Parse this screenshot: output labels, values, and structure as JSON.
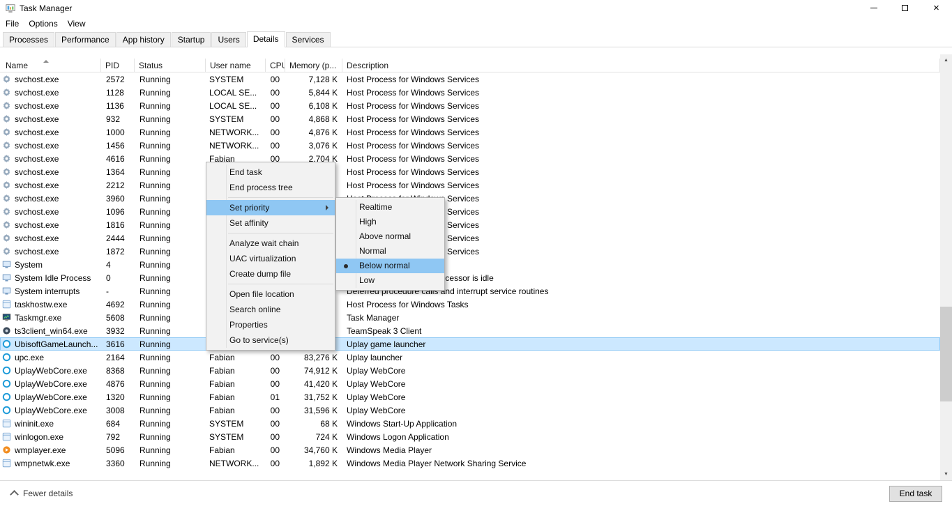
{
  "window": {
    "title": "Task Manager",
    "buttons": [
      {
        "name": "minimize"
      },
      {
        "name": "maximize"
      },
      {
        "name": "close"
      }
    ]
  },
  "menubar": {
    "items": [
      "File",
      "Options",
      "View"
    ]
  },
  "tabs": {
    "items": [
      {
        "label": "Processes"
      },
      {
        "label": "Performance"
      },
      {
        "label": "App history"
      },
      {
        "label": "Startup"
      },
      {
        "label": "Users"
      },
      {
        "label": "Details",
        "active": true
      },
      {
        "label": "Services"
      }
    ]
  },
  "table": {
    "columns": [
      {
        "id": "name",
        "label": "Name",
        "sorted": "asc"
      },
      {
        "id": "pid",
        "label": "PID"
      },
      {
        "id": "status",
        "label": "Status"
      },
      {
        "id": "user",
        "label": "User name"
      },
      {
        "id": "cpu",
        "label": "CPU"
      },
      {
        "id": "mem",
        "label": "Memory (p..."
      },
      {
        "id": "desc",
        "label": "Description"
      }
    ],
    "rows": [
      {
        "icon": "svchost",
        "name": "svchost.exe",
        "pid": "2572",
        "status": "Running",
        "user": "SYSTEM",
        "cpu": "00",
        "mem": "7,128 K",
        "desc": "Host Process for Windows Services"
      },
      {
        "icon": "svchost",
        "name": "svchost.exe",
        "pid": "1128",
        "status": "Running",
        "user": "LOCAL SE...",
        "cpu": "00",
        "mem": "5,844 K",
        "desc": "Host Process for Windows Services"
      },
      {
        "icon": "svchost",
        "name": "svchost.exe",
        "pid": "1136",
        "status": "Running",
        "user": "LOCAL SE...",
        "cpu": "00",
        "mem": "6,108 K",
        "desc": "Host Process for Windows Services"
      },
      {
        "icon": "svchost",
        "name": "svchost.exe",
        "pid": "932",
        "status": "Running",
        "user": "SYSTEM",
        "cpu": "00",
        "mem": "4,868 K",
        "desc": "Host Process for Windows Services"
      },
      {
        "icon": "svchost",
        "name": "svchost.exe",
        "pid": "1000",
        "status": "Running",
        "user": "NETWORK...",
        "cpu": "00",
        "mem": "4,876 K",
        "desc": "Host Process for Windows Services"
      },
      {
        "icon": "svchost",
        "name": "svchost.exe",
        "pid": "1456",
        "status": "Running",
        "user": "NETWORK...",
        "cpu": "00",
        "mem": "3,076 K",
        "desc": "Host Process for Windows Services"
      },
      {
        "icon": "svchost",
        "name": "svchost.exe",
        "pid": "4616",
        "status": "Running",
        "user": "Fabian",
        "cpu": "00",
        "mem": "2,704 K",
        "desc": "Host Process for Windows Services"
      },
      {
        "icon": "svchost",
        "name": "svchost.exe",
        "pid": "1364",
        "status": "Running",
        "user": "",
        "cpu": "",
        "mem": "",
        "desc": "Host Process for Windows Services"
      },
      {
        "icon": "svchost",
        "name": "svchost.exe",
        "pid": "2212",
        "status": "Running",
        "user": "",
        "cpu": "",
        "mem": "",
        "desc": "Host Process for Windows Services"
      },
      {
        "icon": "svchost",
        "name": "svchost.exe",
        "pid": "3960",
        "status": "Running",
        "user": "",
        "cpu": "",
        "mem": "",
        "desc": "Host Process for Windows Services"
      },
      {
        "icon": "svchost",
        "name": "svchost.exe",
        "pid": "1096",
        "status": "Running",
        "user": "",
        "cpu": "",
        "mem": "",
        "desc": "Host Process for Windows Services"
      },
      {
        "icon": "svchost",
        "name": "svchost.exe",
        "pid": "1816",
        "status": "Running",
        "user": "",
        "cpu": "",
        "mem": "",
        "desc": "Host Process for Windows Services"
      },
      {
        "icon": "svchost",
        "name": "svchost.exe",
        "pid": "2444",
        "status": "Running",
        "user": "",
        "cpu": "",
        "mem": "",
        "desc": "Host Process for Windows Services"
      },
      {
        "icon": "svchost",
        "name": "svchost.exe",
        "pid": "1872",
        "status": "Running",
        "user": "",
        "cpu": "",
        "mem": "",
        "desc": "Host Process for Windows Services"
      },
      {
        "icon": "system",
        "name": "System",
        "pid": "4",
        "status": "Running",
        "user": "",
        "cpu": "",
        "mem": "",
        "desc": ""
      },
      {
        "icon": "system",
        "name": "System Idle Process",
        "pid": "0",
        "status": "Running",
        "user": "",
        "cpu": "",
        "mem": "",
        "desc": "Percentage of time the processor is idle"
      },
      {
        "icon": "system",
        "name": "System interrupts",
        "pid": "-",
        "status": "Running",
        "user": "",
        "cpu": "",
        "mem": "",
        "desc": "Deferred procedure calls and interrupt service routines"
      },
      {
        "icon": "window",
        "name": "taskhostw.exe",
        "pid": "4692",
        "status": "Running",
        "user": "",
        "cpu": "",
        "mem": "",
        "desc": "Host Process for Windows Tasks"
      },
      {
        "icon": "taskmgr",
        "name": "Taskmgr.exe",
        "pid": "5608",
        "status": "Running",
        "user": "",
        "cpu": "",
        "mem": "",
        "desc": "Task Manager"
      },
      {
        "icon": "ts3",
        "name": "ts3client_win64.exe",
        "pid": "3932",
        "status": "Running",
        "user": "",
        "cpu": "",
        "mem": "",
        "desc": "TeamSpeak 3 Client"
      },
      {
        "icon": "uplay",
        "name": "UbisoftGameLaunch...",
        "pid": "3616",
        "status": "Running",
        "user": "",
        "cpu": "",
        "mem": "",
        "desc": "Uplay game launcher",
        "selected": true
      },
      {
        "icon": "uplay",
        "name": "upc.exe",
        "pid": "2164",
        "status": "Running",
        "user": "Fabian",
        "cpu": "00",
        "mem": "83,276 K",
        "desc": "Uplay launcher"
      },
      {
        "icon": "uplay",
        "name": "UplayWebCore.exe",
        "pid": "8368",
        "status": "Running",
        "user": "Fabian",
        "cpu": "00",
        "mem": "74,912 K",
        "desc": "Uplay WebCore"
      },
      {
        "icon": "uplay",
        "name": "UplayWebCore.exe",
        "pid": "4876",
        "status": "Running",
        "user": "Fabian",
        "cpu": "00",
        "mem": "41,420 K",
        "desc": "Uplay WebCore"
      },
      {
        "icon": "uplay",
        "name": "UplayWebCore.exe",
        "pid": "1320",
        "status": "Running",
        "user": "Fabian",
        "cpu": "01",
        "mem": "31,752 K",
        "desc": "Uplay WebCore"
      },
      {
        "icon": "uplay",
        "name": "UplayWebCore.exe",
        "pid": "3008",
        "status": "Running",
        "user": "Fabian",
        "cpu": "00",
        "mem": "31,596 K",
        "desc": "Uplay WebCore"
      },
      {
        "icon": "window",
        "name": "wininit.exe",
        "pid": "684",
        "status": "Running",
        "user": "SYSTEM",
        "cpu": "00",
        "mem": "68 K",
        "desc": "Windows Start-Up Application"
      },
      {
        "icon": "window",
        "name": "winlogon.exe",
        "pid": "792",
        "status": "Running",
        "user": "SYSTEM",
        "cpu": "00",
        "mem": "724 K",
        "desc": "Windows Logon Application"
      },
      {
        "icon": "wmp",
        "name": "wmplayer.exe",
        "pid": "5096",
        "status": "Running",
        "user": "Fabian",
        "cpu": "00",
        "mem": "34,760 K",
        "desc": "Windows Media Player"
      },
      {
        "icon": "window",
        "name": "wmpnetwk.exe",
        "pid": "3360",
        "status": "Running",
        "user": "NETWORK...",
        "cpu": "00",
        "mem": "1,892 K",
        "desc": "Windows Media Player Network Sharing Service"
      }
    ]
  },
  "context_menu": {
    "items": [
      {
        "label": "End task"
      },
      {
        "label": "End process tree"
      },
      {
        "separator": true
      },
      {
        "label": "Set priority",
        "highlighted": true,
        "has_submenu": true
      },
      {
        "label": "Set affinity"
      },
      {
        "separator": true
      },
      {
        "label": "Analyze wait chain"
      },
      {
        "label": "UAC virtualization"
      },
      {
        "label": "Create dump file"
      },
      {
        "separator": true
      },
      {
        "label": "Open file location"
      },
      {
        "label": "Search online"
      },
      {
        "label": "Properties"
      },
      {
        "label": "Go to service(s)"
      }
    ]
  },
  "priority_submenu": {
    "items": [
      {
        "label": "Realtime"
      },
      {
        "label": "High"
      },
      {
        "label": "Above normal"
      },
      {
        "label": "Normal"
      },
      {
        "label": "Below normal",
        "highlighted": true,
        "selected_radio": true
      },
      {
        "label": "Low"
      }
    ]
  },
  "footer": {
    "fewer_details": "Fewer details",
    "end_task": "End task"
  },
  "colors": {
    "selection_bg": "#cce8ff",
    "selection_border": "#8ec9f5",
    "menu_highlight": "#8fc7f3",
    "menu_bg": "#f2f2f2",
    "tab_active_bg": "#ffffff"
  }
}
